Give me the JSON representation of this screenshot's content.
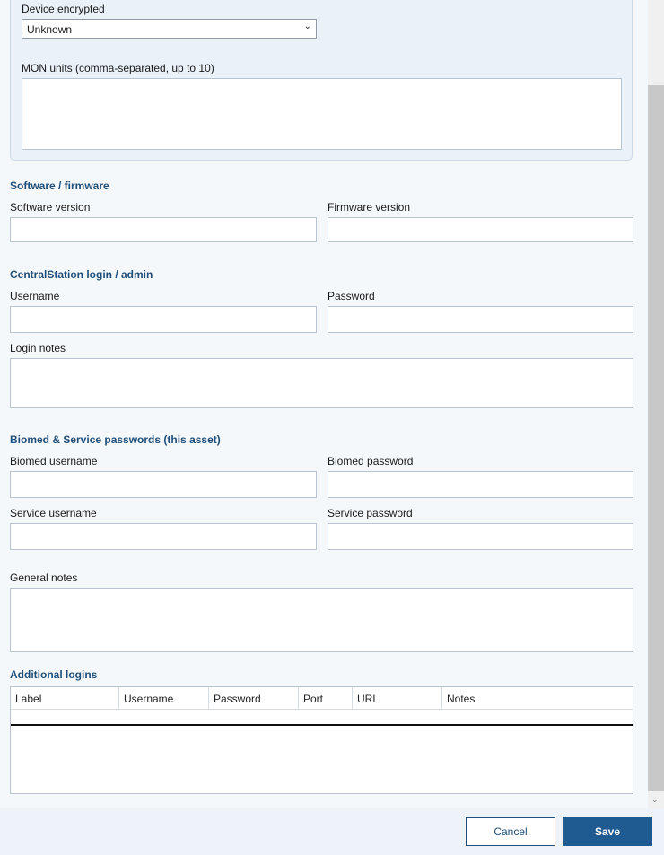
{
  "device": {
    "encrypted_label": "Device encrypted",
    "encrypted_value": "Unknown",
    "mon_units_label": "MON units (comma-separated, up to 10)",
    "mon_units_value": ""
  },
  "software": {
    "section_title": "Software / firmware",
    "software_version_label": "Software version",
    "firmware_version_label": "Firmware version"
  },
  "central_station": {
    "section_title": "CentralStation login / admin",
    "username_label": "Username",
    "password_label": "Password",
    "login_notes_label": "Login notes"
  },
  "biomed": {
    "section_title": "Biomed & Service passwords (this asset)",
    "biomed_username_label": "Biomed username",
    "biomed_password_label": "Biomed password",
    "service_username_label": "Service username",
    "service_password_label": "Service password"
  },
  "general": {
    "notes_label": "General notes"
  },
  "additional_logins": {
    "section_title": "Additional logins",
    "columns": [
      "Label",
      "Username",
      "Password",
      "Port",
      "URL",
      "Notes"
    ]
  },
  "footer": {
    "cancel_label": "Cancel",
    "save_label": "Save"
  },
  "colors": {
    "accent": "#1f4e79",
    "save_button": "#1f5a91"
  },
  "icons": {
    "dropdown": "chevron-down-icon",
    "scroll_down": "scroll-down-arrow-icon"
  }
}
